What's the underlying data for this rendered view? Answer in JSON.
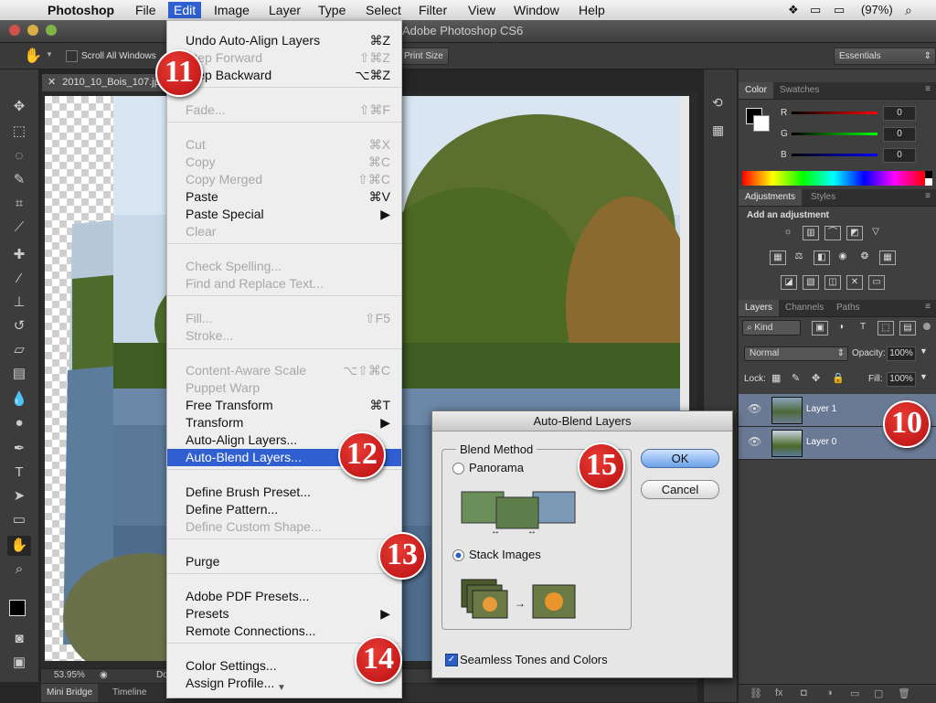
{
  "menubar": {
    "app": "Photoshop",
    "items": [
      "File",
      "Edit",
      "Image",
      "Layer",
      "Type",
      "Select",
      "Filter",
      "View",
      "Window",
      "Help"
    ],
    "active": "Edit",
    "battery": "(97%)"
  },
  "window": {
    "title": "Adobe Photoshop CS6"
  },
  "options": {
    "scroll_all": "Scroll All Windows",
    "print_size": "Print Size",
    "workspace": "Essentials"
  },
  "document": {
    "tab": "2010_10_Bois_107.jp",
    "zoom": "53.95%",
    "doc_partial": "Do"
  },
  "bottom_tabs": [
    "Mini Bridge",
    "Timeline"
  ],
  "edit_menu": {
    "items": [
      {
        "label": "Undo Auto-Align Layers",
        "shortcut": "⌘Z",
        "state": "normal"
      },
      {
        "label": "Step Forward",
        "shortcut": "⇧⌘Z",
        "state": "disabled"
      },
      {
        "label": "Step Backward",
        "shortcut": "⌥⌘Z",
        "state": "normal"
      },
      {
        "label": "Fade...",
        "shortcut": "⇧⌘F",
        "state": "disabled"
      },
      {
        "label": "Cut",
        "shortcut": "⌘X",
        "state": "disabled"
      },
      {
        "label": "Copy",
        "shortcut": "⌘C",
        "state": "disabled"
      },
      {
        "label": "Copy Merged",
        "shortcut": "⇧⌘C",
        "state": "disabled"
      },
      {
        "label": "Paste",
        "shortcut": "⌘V",
        "state": "normal"
      },
      {
        "label": "Paste Special",
        "shortcut": "▶",
        "state": "normal"
      },
      {
        "label": "Clear",
        "shortcut": "",
        "state": "disabled"
      },
      {
        "label": "Check Spelling...",
        "shortcut": "",
        "state": "disabled"
      },
      {
        "label": "Find and Replace Text...",
        "shortcut": "",
        "state": "disabled"
      },
      {
        "label": "Fill...",
        "shortcut": "⇧F5",
        "state": "disabled"
      },
      {
        "label": "Stroke...",
        "shortcut": "",
        "state": "disabled"
      },
      {
        "label": "Content-Aware Scale",
        "shortcut": "⌥⇧⌘C",
        "state": "disabled"
      },
      {
        "label": "Puppet Warp",
        "shortcut": "",
        "state": "disabled"
      },
      {
        "label": "Free Transform",
        "shortcut": "⌘T",
        "state": "normal"
      },
      {
        "label": "Transform",
        "shortcut": "▶",
        "state": "normal"
      },
      {
        "label": "Auto-Align Layers...",
        "shortcut": "",
        "state": "normal"
      },
      {
        "label": "Auto-Blend Layers...",
        "shortcut": "",
        "state": "highlighted"
      },
      {
        "label": "Define Brush Preset...",
        "shortcut": "",
        "state": "normal"
      },
      {
        "label": "Define Pattern...",
        "shortcut": "",
        "state": "normal"
      },
      {
        "label": "Define Custom Shape...",
        "shortcut": "",
        "state": "disabled"
      },
      {
        "label": "Purge",
        "shortcut": "",
        "state": "normal"
      },
      {
        "label": "Adobe PDF Presets...",
        "shortcut": "",
        "state": "normal"
      },
      {
        "label": "Presets",
        "shortcut": "▶",
        "state": "normal"
      },
      {
        "label": "Remote Connections...",
        "shortcut": "",
        "state": "normal"
      },
      {
        "label": "Color Settings...",
        "shortcut": "",
        "state": "normal"
      },
      {
        "label": "Assign Profile...",
        "shortcut": "",
        "state": "normal"
      }
    ]
  },
  "color_panel": {
    "tabs": [
      "Color",
      "Swatches"
    ],
    "channels": [
      {
        "name": "R",
        "value": "0"
      },
      {
        "name": "G",
        "value": "0"
      },
      {
        "name": "B",
        "value": "0"
      }
    ]
  },
  "adjustments_panel": {
    "tabs": [
      "Adjustments",
      "Styles"
    ],
    "heading": "Add an adjustment"
  },
  "layers_panel": {
    "tabs": [
      "Layers",
      "Channels",
      "Paths"
    ],
    "kind": "Kind",
    "blend_mode": "Normal",
    "opacity_label": "Opacity:",
    "opacity": "100%",
    "lock_label": "Lock:",
    "fill_label": "Fill:",
    "fill": "100%",
    "layers": [
      {
        "name": "Layer 1"
      },
      {
        "name": "Layer 0"
      }
    ]
  },
  "dialog": {
    "title": "Auto-Blend Layers",
    "group": "Blend Method",
    "panorama": "Panorama",
    "stack": "Stack Images",
    "seamless": "Seamless Tones and Colors",
    "ok": "OK",
    "cancel": "Cancel"
  },
  "callouts": [
    "11",
    "12",
    "13",
    "14",
    "15",
    "10"
  ]
}
